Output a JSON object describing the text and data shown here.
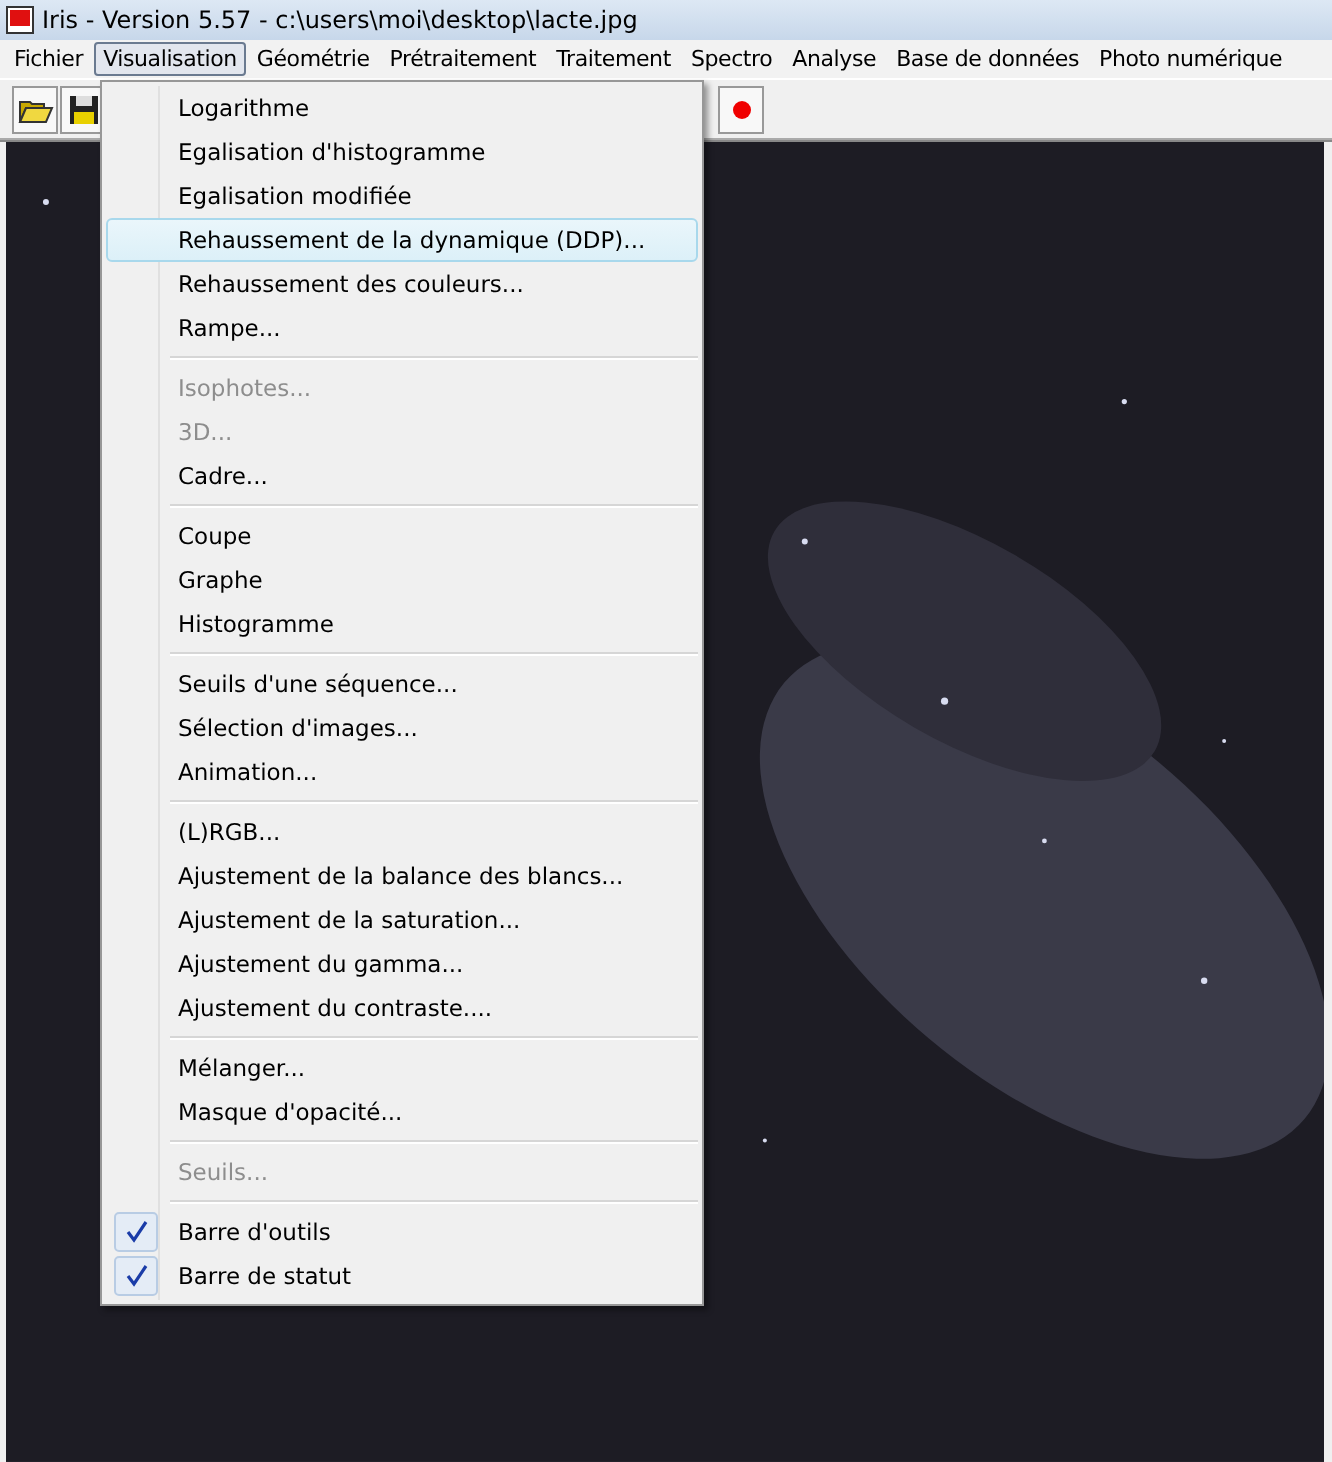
{
  "window": {
    "title": "Iris - Version 5.57 - c:\\users\\moi\\desktop\\lacte.jpg"
  },
  "menubar": [
    {
      "label": "Fichier",
      "selected": false
    },
    {
      "label": "Visualisation",
      "selected": true
    },
    {
      "label": "Géométrie",
      "selected": false
    },
    {
      "label": "Prétraitement",
      "selected": false
    },
    {
      "label": "Traitement",
      "selected": false
    },
    {
      "label": "Spectro",
      "selected": false
    },
    {
      "label": "Analyse",
      "selected": false
    },
    {
      "label": "Base de données",
      "selected": false
    },
    {
      "label": "Photo numérique",
      "selected": false
    }
  ],
  "menu": {
    "groups": [
      [
        {
          "label": "Logarithme",
          "disabled": false,
          "checked": false,
          "selected": false
        },
        {
          "label": "Egalisation d'histogramme",
          "disabled": false,
          "checked": false,
          "selected": false
        },
        {
          "label": "Egalisation modifiée",
          "disabled": false,
          "checked": false,
          "selected": false
        },
        {
          "label": "Rehaussement de la dynamique (DDP)...",
          "disabled": false,
          "checked": false,
          "selected": true
        },
        {
          "label": "Rehaussement des couleurs...",
          "disabled": false,
          "checked": false,
          "selected": false
        },
        {
          "label": "Rampe...",
          "disabled": false,
          "checked": false,
          "selected": false
        }
      ],
      [
        {
          "label": "Isophotes...",
          "disabled": true,
          "checked": false,
          "selected": false
        },
        {
          "label": "3D...",
          "disabled": true,
          "checked": false,
          "selected": false
        },
        {
          "label": "Cadre...",
          "disabled": false,
          "checked": false,
          "selected": false
        }
      ],
      [
        {
          "label": "Coupe",
          "disabled": false,
          "checked": false,
          "selected": false
        },
        {
          "label": "Graphe",
          "disabled": false,
          "checked": false,
          "selected": false
        },
        {
          "label": "Histogramme",
          "disabled": false,
          "checked": false,
          "selected": false
        }
      ],
      [
        {
          "label": "Seuils d'une séquence...",
          "disabled": false,
          "checked": false,
          "selected": false
        },
        {
          "label": "Sélection d'images...",
          "disabled": false,
          "checked": false,
          "selected": false
        },
        {
          "label": "Animation...",
          "disabled": false,
          "checked": false,
          "selected": false
        }
      ],
      [
        {
          "label": "(L)RGB...",
          "disabled": false,
          "checked": false,
          "selected": false
        },
        {
          "label": "Ajustement de la balance des blancs...",
          "disabled": false,
          "checked": false,
          "selected": false
        },
        {
          "label": "Ajustement de la saturation...",
          "disabled": false,
          "checked": false,
          "selected": false
        },
        {
          "label": "Ajustement du gamma...",
          "disabled": false,
          "checked": false,
          "selected": false
        },
        {
          "label": "Ajustement du contraste....",
          "disabled": false,
          "checked": false,
          "selected": false
        }
      ],
      [
        {
          "label": "Mélanger...",
          "disabled": false,
          "checked": false,
          "selected": false
        },
        {
          "label": "Masque d'opacité...",
          "disabled": false,
          "checked": false,
          "selected": false
        }
      ],
      [
        {
          "label": "Seuils...",
          "disabled": true,
          "checked": false,
          "selected": false
        }
      ],
      [
        {
          "label": "Barre d'outils",
          "disabled": false,
          "checked": true,
          "selected": false
        },
        {
          "label": "Barre de statut",
          "disabled": false,
          "checked": true,
          "selected": false
        }
      ]
    ]
  }
}
